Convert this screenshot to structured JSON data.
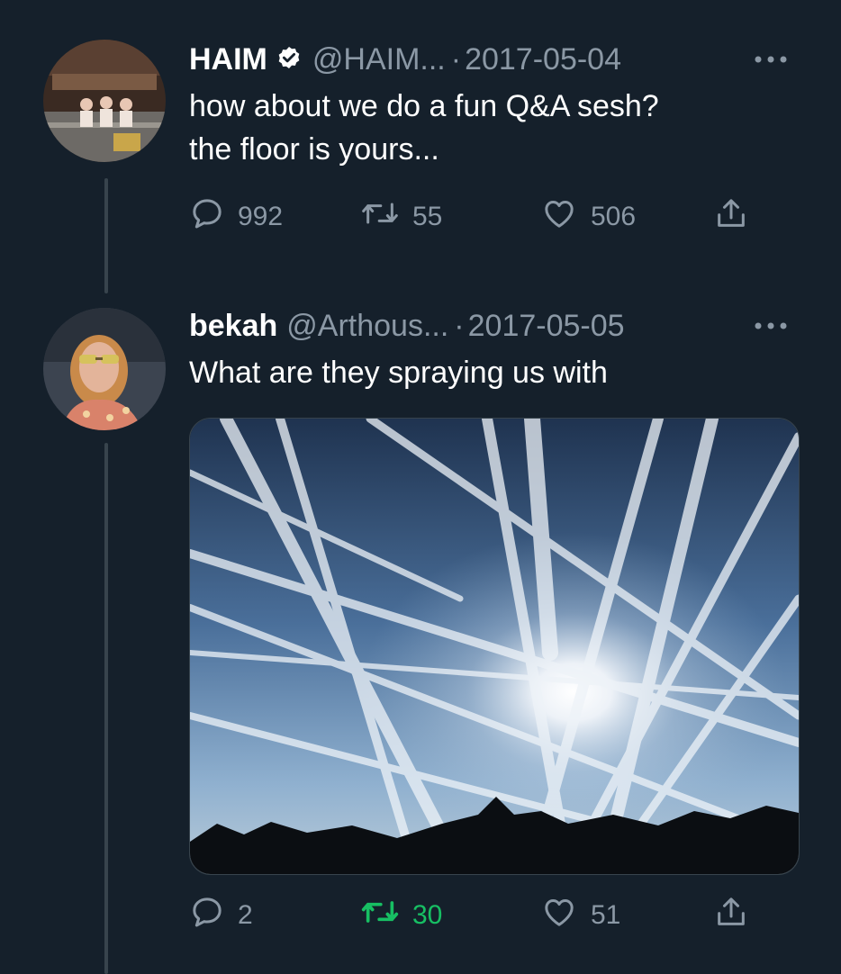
{
  "tweets": [
    {
      "name": "HAIM",
      "verified": true,
      "handle": "@HAIM...",
      "separator": "·",
      "date": "2017-05-04",
      "text": "how about we do a fun Q&A sesh?\nthe floor is yours...",
      "replies": "992",
      "retweets": "55",
      "likes": "506",
      "retweeted": false
    },
    {
      "name": "bekah",
      "verified": false,
      "handle": "@Arthous...",
      "separator": "·",
      "date": "2017-05-05",
      "text": "What are they spraying us with",
      "replies": "2",
      "retweets": "30",
      "likes": "51",
      "retweeted": true,
      "has_media": true
    }
  ],
  "icons": {
    "reply": "reply-icon",
    "retweet": "retweet-icon",
    "like": "heart-icon",
    "share": "share-icon",
    "more": "more-options-icon",
    "verified": "verified-badge-icon"
  },
  "colors": {
    "background": "#15202b",
    "secondary_text": "#8b98a5",
    "thread_line": "#38444d",
    "retweet_active": "#17bf63",
    "verified_badge": "#ffffff"
  }
}
